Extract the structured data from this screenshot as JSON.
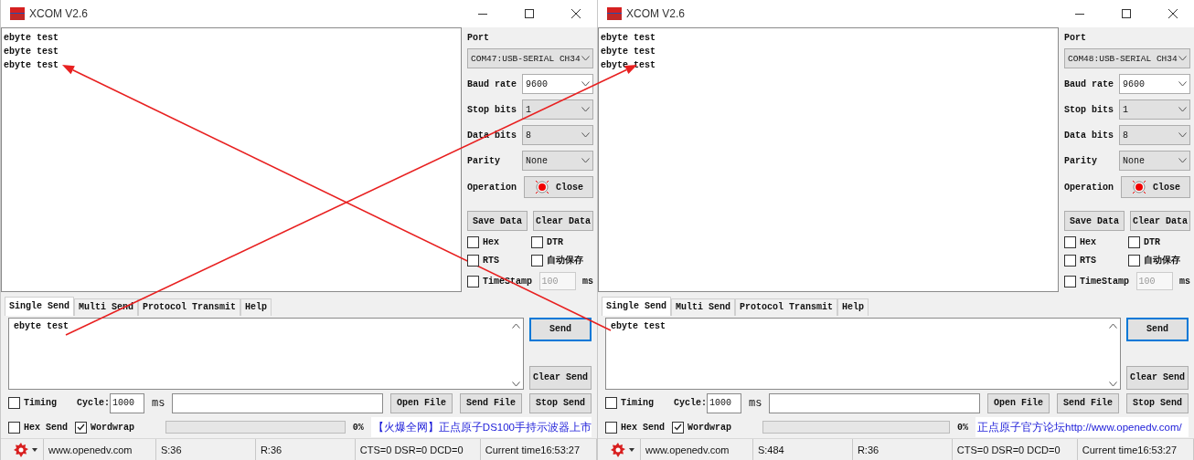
{
  "windows": [
    {
      "title": "XCOM V2.6",
      "receive_lines": [
        "ebyte test",
        "ebyte test",
        "ebyte test"
      ],
      "port": {
        "label": "Port",
        "value": "COM47:USB-SERIAL CH34"
      },
      "fields": [
        {
          "label": "Baud rate",
          "value": "9600",
          "editable": true
        },
        {
          "label": "Stop bits",
          "value": "1",
          "editable": false
        },
        {
          "label": "Data bits",
          "value": "8",
          "editable": false
        },
        {
          "label": "Parity",
          "value": "None",
          "editable": false
        }
      ],
      "operation": {
        "label": "Operation",
        "button": "Close"
      },
      "data_buttons": [
        "Save Data",
        "Clear Data"
      ],
      "options": [
        {
          "label": "Hex",
          "checked": false
        },
        {
          "label": "DTR",
          "checked": false
        },
        {
          "label": "RTS",
          "checked": false
        },
        {
          "label": "自动保存",
          "checked": false
        }
      ],
      "timestamp": {
        "label": "TimeStamp",
        "checked": false,
        "value": "100",
        "disabled": true,
        "unit": "ms"
      },
      "tabs": [
        {
          "label": "Single Send",
          "selected": true
        },
        {
          "label": "Multi Send",
          "selected": false
        },
        {
          "label": "Protocol Transmit",
          "selected": false
        },
        {
          "label": "Help",
          "selected": false
        }
      ],
      "send_text": "ebyte test",
      "send_buttons": [
        "Send",
        "Clear Send"
      ],
      "timing": {
        "label": "Timing",
        "checked": false
      },
      "cycle": {
        "label": "Cycle:",
        "value": "1000",
        "unit": "ms"
      },
      "file_buttons": [
        "Open File",
        "Send File",
        "Stop Send"
      ],
      "hex_send": {
        "label": "Hex Send",
        "checked": false
      },
      "wordwrap": {
        "label": "Wordwrap",
        "checked": true
      },
      "progress": {
        "level": 0,
        "reading": "0%"
      },
      "banner": "【火爆全网】正点原子DS100手持示波器上市",
      "status": [
        "www.openedv.com",
        "S:36",
        "R:36",
        "CTS=0 DSR=0 DCD=0",
        "Current time16:53:27"
      ]
    },
    {
      "title": "XCOM V2.6",
      "receive_lines": [
        "ebyte test",
        "ebyte test",
        "ebyte test"
      ],
      "port": {
        "label": "Port",
        "value": "COM48:USB-SERIAL CH34"
      },
      "fields": [
        {
          "label": "Baud rate",
          "value": "9600",
          "editable": true
        },
        {
          "label": "Stop bits",
          "value": "1",
          "editable": false
        },
        {
          "label": "Data bits",
          "value": "8",
          "editable": false
        },
        {
          "label": "Parity",
          "value": "None",
          "editable": false
        }
      ],
      "operation": {
        "label": "Operation",
        "button": "Close"
      },
      "data_buttons": [
        "Save Data",
        "Clear Data"
      ],
      "options": [
        {
          "label": "Hex",
          "checked": false
        },
        {
          "label": "DTR",
          "checked": false
        },
        {
          "label": "RTS",
          "checked": false
        },
        {
          "label": "自动保存",
          "checked": false
        }
      ],
      "timestamp": {
        "label": "TimeStamp",
        "checked": false,
        "value": "100",
        "disabled": true,
        "unit": "ms"
      },
      "tabs": [
        {
          "label": "Single Send",
          "selected": true
        },
        {
          "label": "Multi Send",
          "selected": false
        },
        {
          "label": "Protocol Transmit",
          "selected": false
        },
        {
          "label": "Help",
          "selected": false
        }
      ],
      "send_text": "ebyte test",
      "send_buttons": [
        "Send",
        "Clear Send"
      ],
      "timing": {
        "label": "Timing",
        "checked": false
      },
      "cycle": {
        "label": "Cycle:",
        "value": "1000",
        "unit": "ms"
      },
      "file_buttons": [
        "Open File",
        "Send File",
        "Stop Send"
      ],
      "hex_send": {
        "label": "Hex Send",
        "checked": false
      },
      "wordwrap": {
        "label": "Wordwrap",
        "checked": true
      },
      "progress": {
        "level": 0,
        "reading": "0%"
      },
      "banner": "正点原子官方论坛http://www.openedv.com/",
      "status": [
        "www.openedv.com",
        "S:484",
        "R:36",
        "CTS=0 DSR=0 DCD=0",
        "Current time16:53:27"
      ]
    }
  ]
}
